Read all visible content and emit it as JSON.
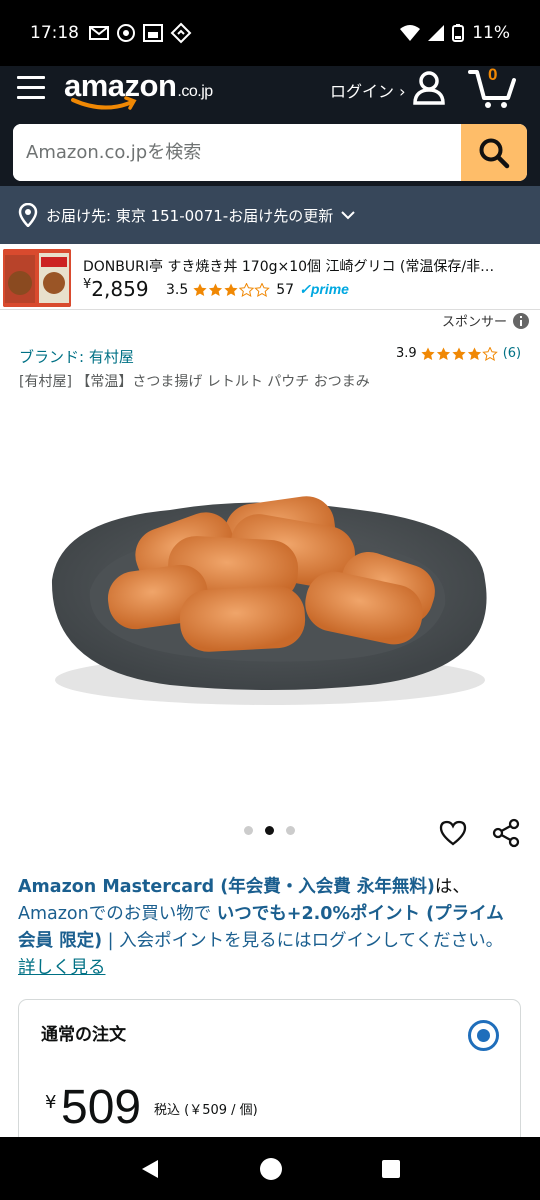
{
  "status_bar": {
    "time": "17:18",
    "battery": "11%"
  },
  "header": {
    "logo_text": "amazon",
    "logo_tld": ".co.jp",
    "login_label": "ログイン ›",
    "cart_count": "0",
    "search_placeholder": "Amazon.co.jpを検索"
  },
  "delivery": {
    "text": "お届け先: 東京 151-0071‐お届け先の更新"
  },
  "sponsored_product": {
    "title": "DONBURI亭 すき焼き丼 170g×10個 江崎グリコ (常温保存/非…",
    "price_symbol": "¥",
    "price": "2,859",
    "rating": "3.5",
    "review_count": "57",
    "prime_label": "✓prime",
    "sponsor_label": "スポンサー"
  },
  "product": {
    "brand": "ブランド: 有村屋",
    "rating": "3.9",
    "review_count": "(6)",
    "title": "[有村屋] 【常温】さつま揚げ レトルト パウチ おつまみ"
  },
  "image_carousel": {
    "count": 3,
    "active_index": 1
  },
  "promo": {
    "part1": "Amazon Mastercard (年会費・入会費 永年無料)",
    "part2": "は、",
    "part3": "Amazonでのお買い物で ",
    "part4": "いつでも+2.0%ポイント (プライム会員 限定)",
    "part5": " | 入会ポイントを見るにはログインしてください。",
    "link": "詳しく見る"
  },
  "order": {
    "title": "通常の注文",
    "price_symbol": "¥",
    "price": "509",
    "price_note": "税込 (￥509 / 個)"
  },
  "colors": {
    "header_bg": "#131921",
    "delivery_bg": "#37475a",
    "search_button": "#febd69",
    "link": "#007185",
    "star": "#f08804",
    "prime": "#00a8e1"
  }
}
